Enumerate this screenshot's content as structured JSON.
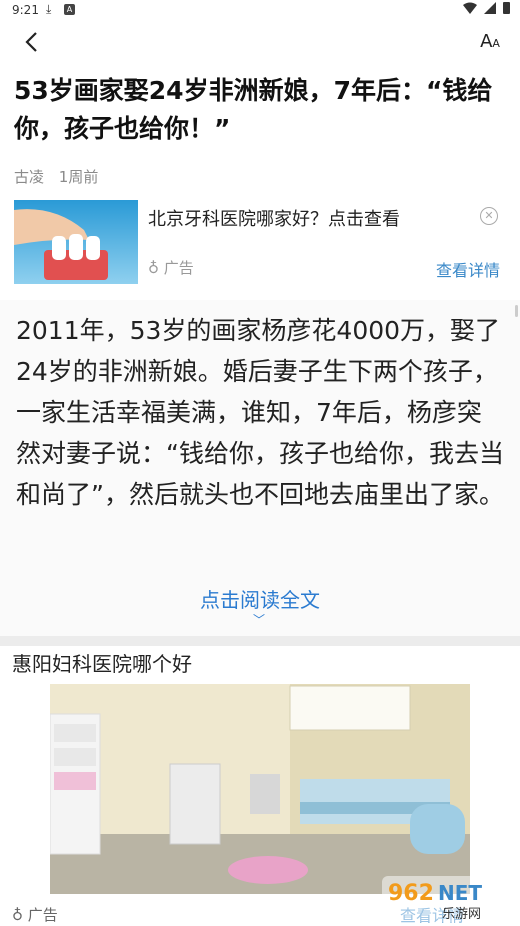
{
  "status_bar": {
    "time": "9:21"
  },
  "toolbar": {
    "font_label": "A"
  },
  "article": {
    "title": "53岁画家娶24岁非洲新娘，7年后：“钱给你，孩子也给你！”",
    "author": "古凌",
    "time": "1周前",
    "body": "2011年，53岁的画家杨彦花4000万，娶了24岁的非洲新娘。婚后妻子生下两个孩子，一家生活幸福美满，谁知，7年后，杨彦突然对妻子说：“钱给你，孩子也给你，我去当和尚了”，然后就头也不回地去庙里出了家。",
    "read_more": "点击阅读全文"
  },
  "ad_top": {
    "headline": "北京牙科医院哪家好？点击查看",
    "tag": "广告",
    "detail": "查看详情"
  },
  "ad_bottom": {
    "title": "惠阳妇科医院哪个好",
    "tag": "广告",
    "detail": "查看详情"
  },
  "watermark": {
    "text": "962NET",
    "sub": "乐游网"
  },
  "colors": {
    "link": "#2b7bd0",
    "detail": "#3a88c8",
    "divider": "#ececec"
  }
}
